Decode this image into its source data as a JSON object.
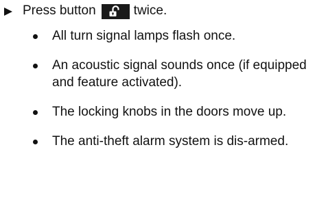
{
  "instruction": {
    "before": "Press button",
    "after": "twice.",
    "button_icon": "unlock-icon"
  },
  "results": [
    {
      "text": "All turn signal lamps flash once."
    },
    {
      "text": "An acoustic signal sounds once (if equipped and feature activated)."
    },
    {
      "text": "The locking knobs in the doors move up."
    },
    {
      "text": "The anti-theft alarm system is dis-armed."
    }
  ],
  "colors": {
    "text": "#111111",
    "key_background": "#1a1a1a",
    "key_icon": "#ffffff"
  }
}
